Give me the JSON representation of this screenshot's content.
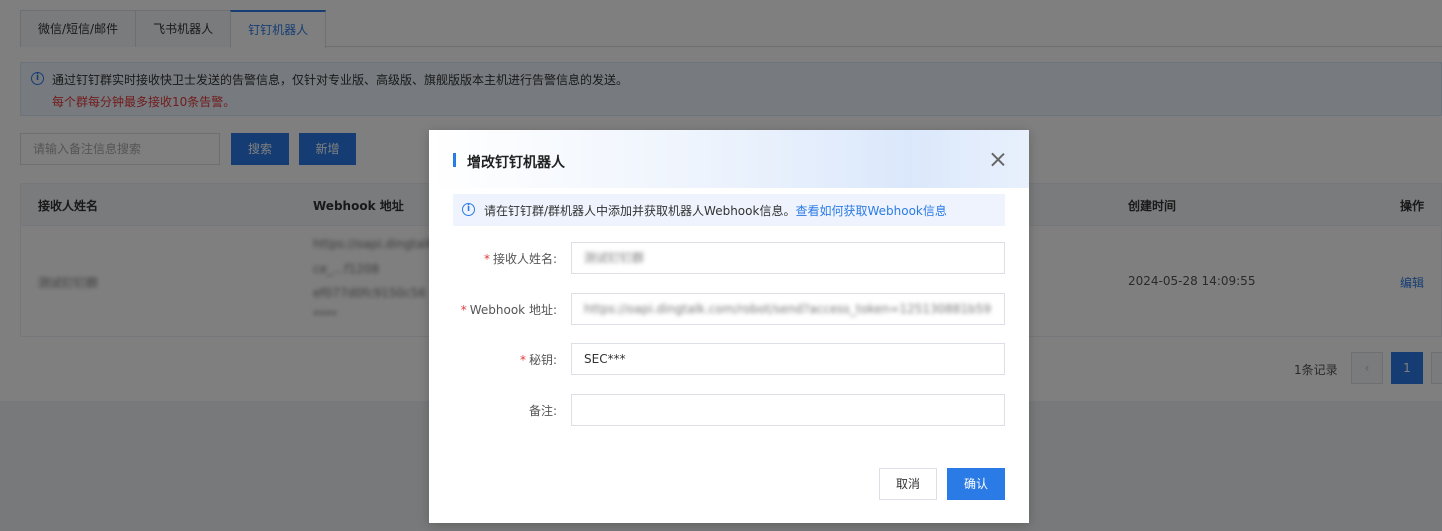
{
  "tabs": [
    {
      "label": "微信/短信/邮件"
    },
    {
      "label": "飞书机器人"
    },
    {
      "label": "钉钉机器人"
    }
  ],
  "notice": {
    "line1": "通过钉钉群实时接收快卫士发送的告警信息，仅针对专业版、高级版、旗舰版版本主机进行告警信息的发送。",
    "line2": "每个群每分钟最多接收10条告警。"
  },
  "toolbar": {
    "search_placeholder": "请输入备注信息搜索",
    "search_label": "搜索",
    "add_label": "新增"
  },
  "table": {
    "columns": [
      "接收人姓名",
      "Webhook 地址",
      "创建时间",
      "操作"
    ],
    "rows": [
      {
        "name": "测试钉钉群",
        "webhook_lines": [
          "https://oapi.dingtalk",
          "ce_...f1208",
          "ef077d0fc9150c56",
          "****"
        ],
        "created": "2024-05-28 14:09:55",
        "action": "编辑"
      }
    ]
  },
  "pager": {
    "total": "1条记录",
    "current": "1",
    "prev_icon": "chevron-left-icon"
  },
  "modal": {
    "title": "增改钉钉机器人",
    "tip_text": "请在钉钉群/群机器人中添加并获取机器人Webhook信息。",
    "tip_link": "查看如何获取Webhook信息",
    "fields": {
      "name_label": "接收人姓名:",
      "name_value": "测试钉钉群",
      "webhook_label": "Webhook 地址:",
      "webhook_value": "https://oapi.dingtalk.com/robot/send?access_token=125130881b59",
      "secret_label": "秘钥:",
      "secret_value": "SEC***",
      "note_label": "备注:",
      "note_value": ""
    },
    "cancel_label": "取消",
    "ok_label": "确认"
  },
  "colors": {
    "accent": "#2b7be6",
    "required": "#e23b3b"
  }
}
